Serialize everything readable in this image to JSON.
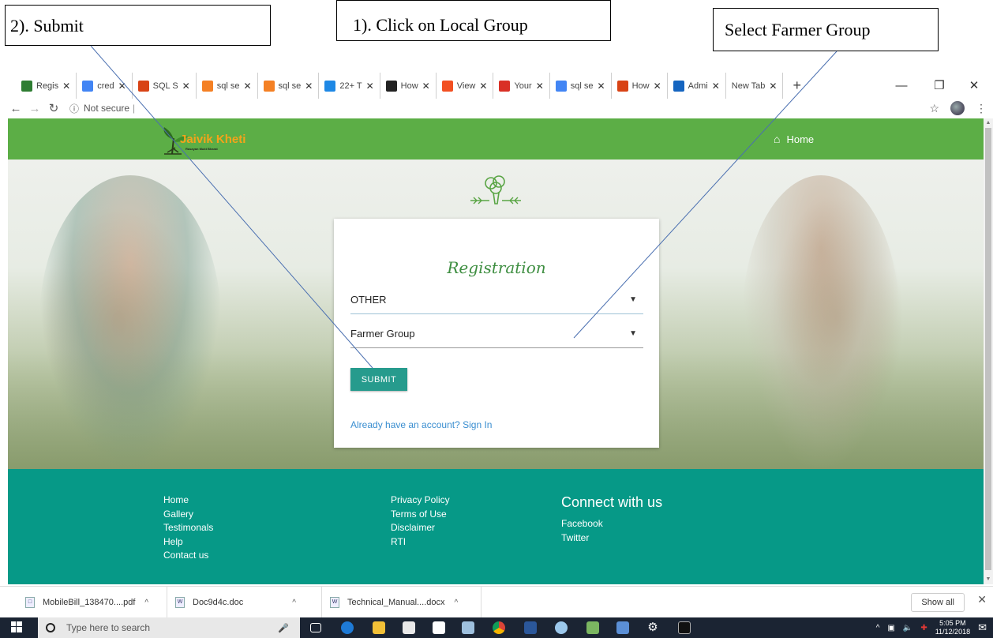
{
  "annotations": {
    "submit": "2). Submit",
    "local_group": "1). Click on Local Group",
    "farmer_group": "Select Farmer Group"
  },
  "browser": {
    "tabs": [
      {
        "label": "Regis",
        "icon": "mountain-icon",
        "color": "#2e7d32"
      },
      {
        "label": "cred",
        "icon": "google-icon",
        "color": "#4285f4"
      },
      {
        "label": "SQL S",
        "icon": "sql-icon",
        "color": "#d84315"
      },
      {
        "label": "sql se",
        "icon": "stack-icon",
        "color": "#f48024"
      },
      {
        "label": "sql se",
        "icon": "stack-icon",
        "color": "#f48024"
      },
      {
        "label": "22+ T",
        "icon": "t-icon",
        "color": "#1e88e5"
      },
      {
        "label": "How",
        "icon": "htg-icon",
        "color": "#222222"
      },
      {
        "label": "View",
        "icon": "windows-icon",
        "color": "#f25022"
      },
      {
        "label": "Your",
        "icon": "gmail-icon",
        "color": "#d93025"
      },
      {
        "label": "sql se",
        "icon": "google-icon",
        "color": "#4285f4"
      },
      {
        "label": "How",
        "icon": "sql-icon",
        "color": "#d84315"
      },
      {
        "label": "Admi",
        "icon": "gear-icon",
        "color": "#1565c0"
      },
      {
        "label": "New Tab",
        "icon": "",
        "color": "#ffffff"
      }
    ],
    "new_tab": "+",
    "address": "Not secure",
    "security_label": "ⓘ"
  },
  "site": {
    "brand": "Jaivik Kheti",
    "tagline": "Rasayan Mukt Bharat",
    "nav_home": "Home"
  },
  "registration": {
    "title": "Registration",
    "select_type": "OTHER",
    "select_group": "Farmer Group",
    "submit": "SUBMIT",
    "signin": "Already have an account? Sign In"
  },
  "footer": {
    "col1": [
      "Home",
      "Gallery",
      "Testimonals",
      "Help",
      "Contact us"
    ],
    "col2": [
      "Privacy Policy",
      "Terms of Use",
      "Disclaimer",
      "RTI"
    ],
    "connect_title": "Connect with us",
    "col3": [
      "Facebook",
      "Twitter"
    ]
  },
  "downloads": {
    "items": [
      "MobileBill_138470....pdf",
      "Doc9d4c.doc",
      "Technical_Manual....docx"
    ],
    "show_all": "Show all"
  },
  "taskbar": {
    "search_placeholder": "Type here to search",
    "time": "5:05 PM",
    "date": "11/12/2018"
  },
  "colors": {
    "header_green": "#5cae46",
    "footer_teal": "#069987",
    "button_teal": "#269b8d",
    "link_blue": "#3a8ed0"
  }
}
